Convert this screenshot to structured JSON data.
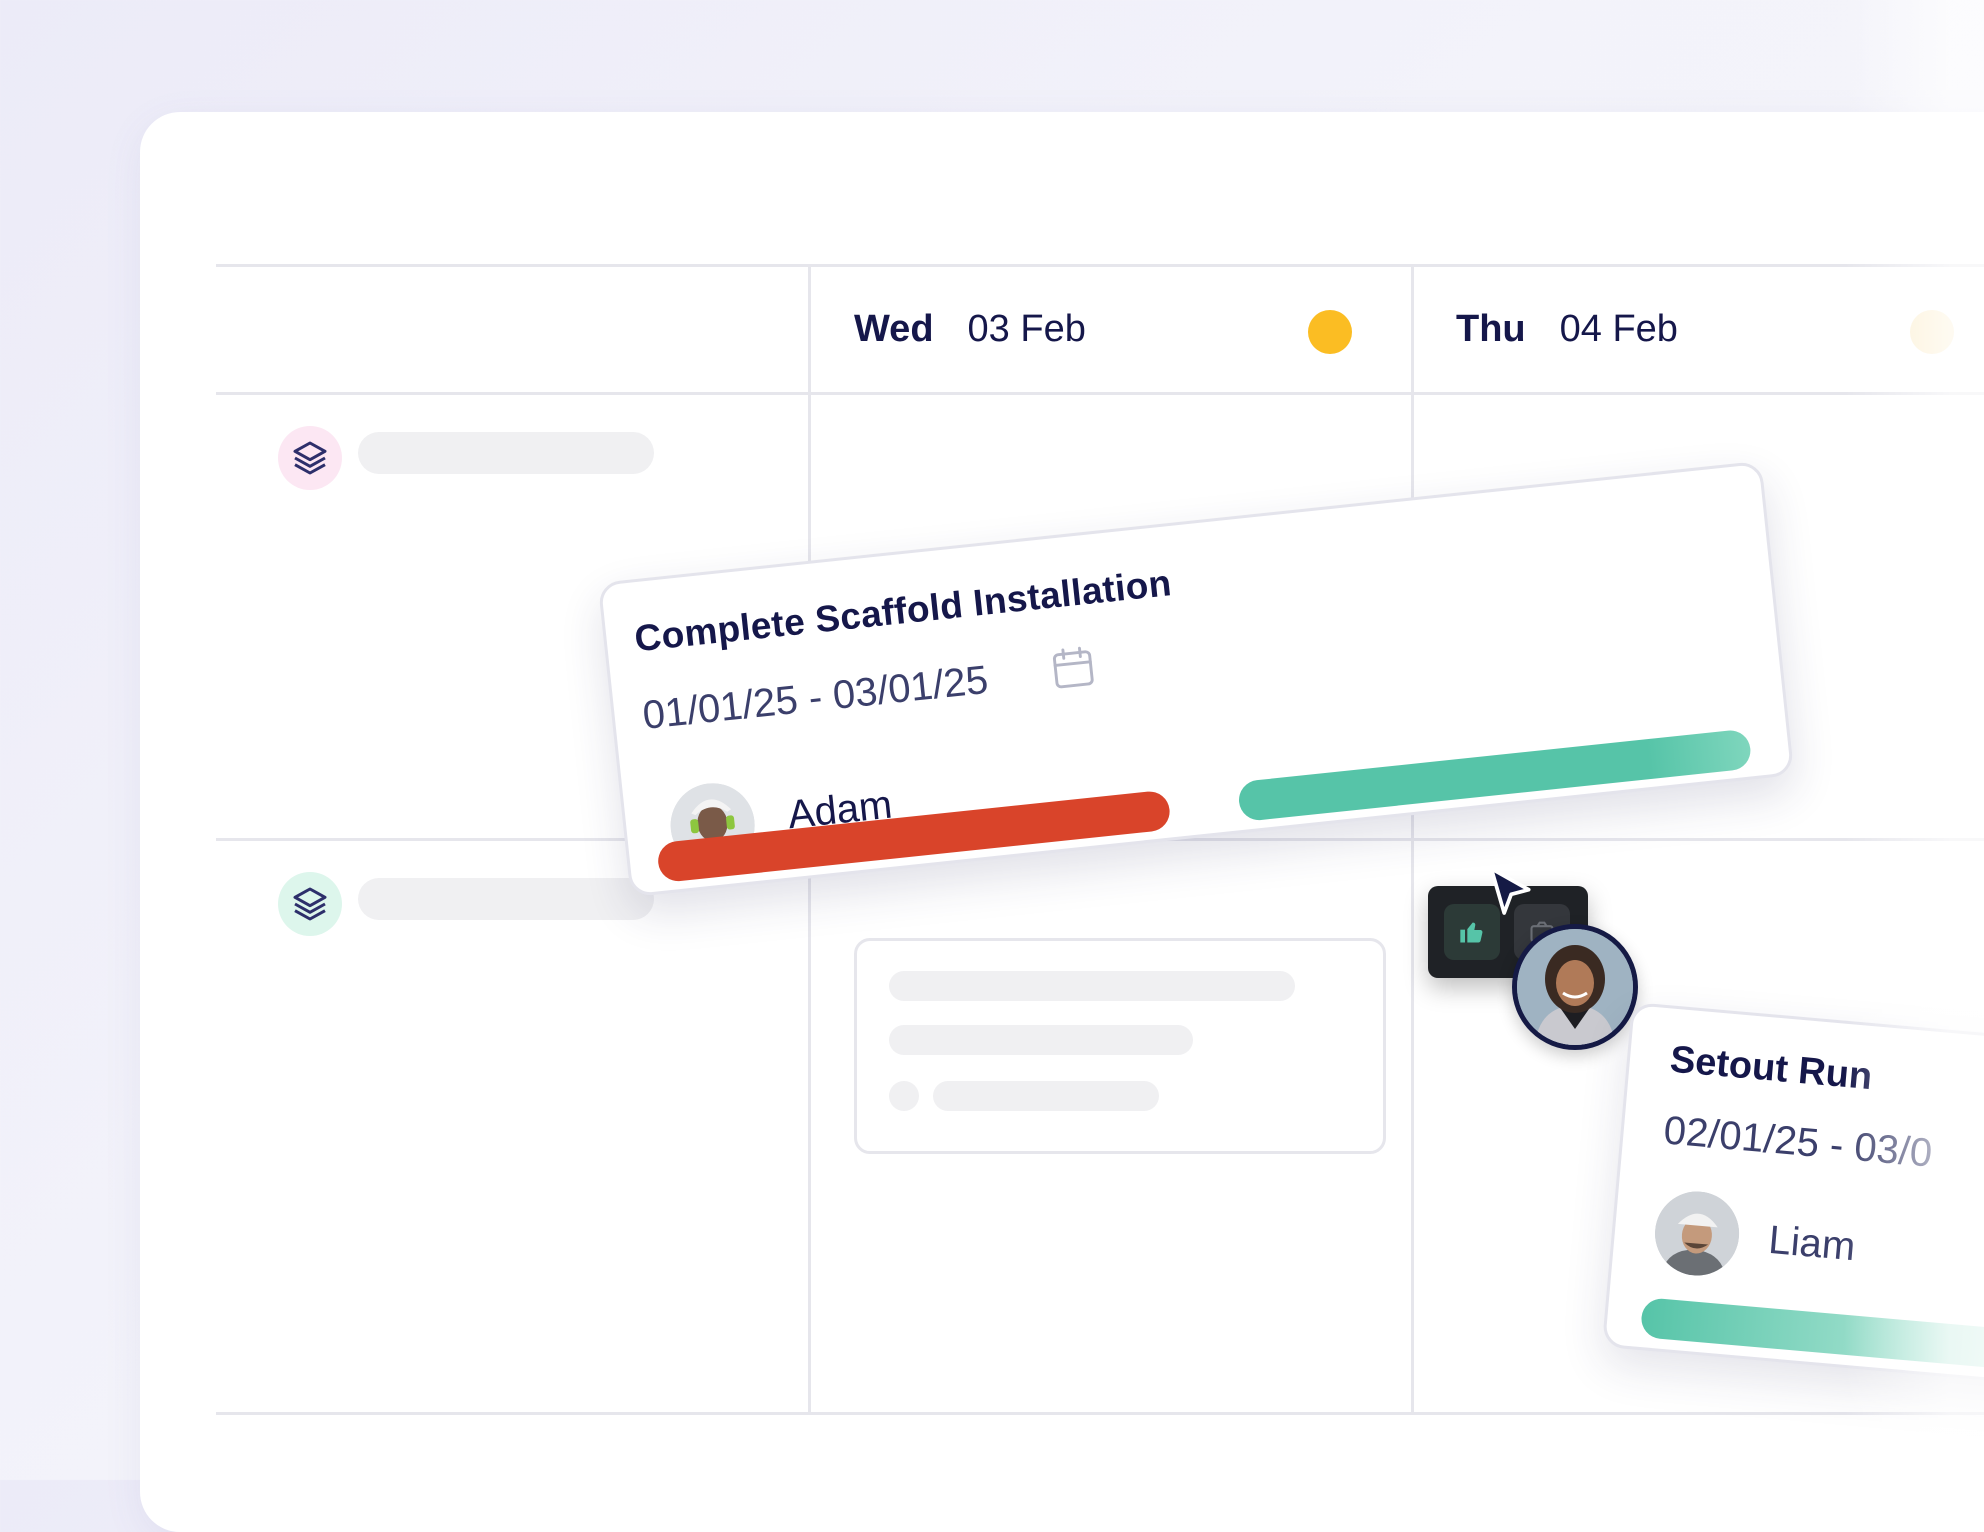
{
  "days": [
    {
      "name": "Wed",
      "date": "03 Feb",
      "indicator_color": "#FBBD23"
    },
    {
      "name": "Thu",
      "date": "04 Feb",
      "indicator_color": "#FCEFD0"
    }
  ],
  "rows": [
    {
      "icon": "layers-icon",
      "badge_color": "#FCE7F3",
      "icon_color": "#2d2f6b"
    },
    {
      "icon": "layers-icon",
      "badge_color": "#DDF6EC",
      "icon_color": "#2d2f6b"
    }
  ],
  "main_card": {
    "title": "Complete Scaffold Installation",
    "dates": "01/01/25 - 03/01/25",
    "assignee": "Adam",
    "bars": [
      {
        "color": "#D9442A"
      },
      {
        "color": "#56C4A8"
      }
    ]
  },
  "actions": {
    "approve_icon": "thumbs-up-icon",
    "approve_color": "#56C4A8",
    "second_icon": "camera-icon"
  },
  "side_card": {
    "title": "Setout Run",
    "dates": "02/01/25 - 03/0",
    "assignee": "Liam",
    "bar_color": "#56C4A8"
  }
}
